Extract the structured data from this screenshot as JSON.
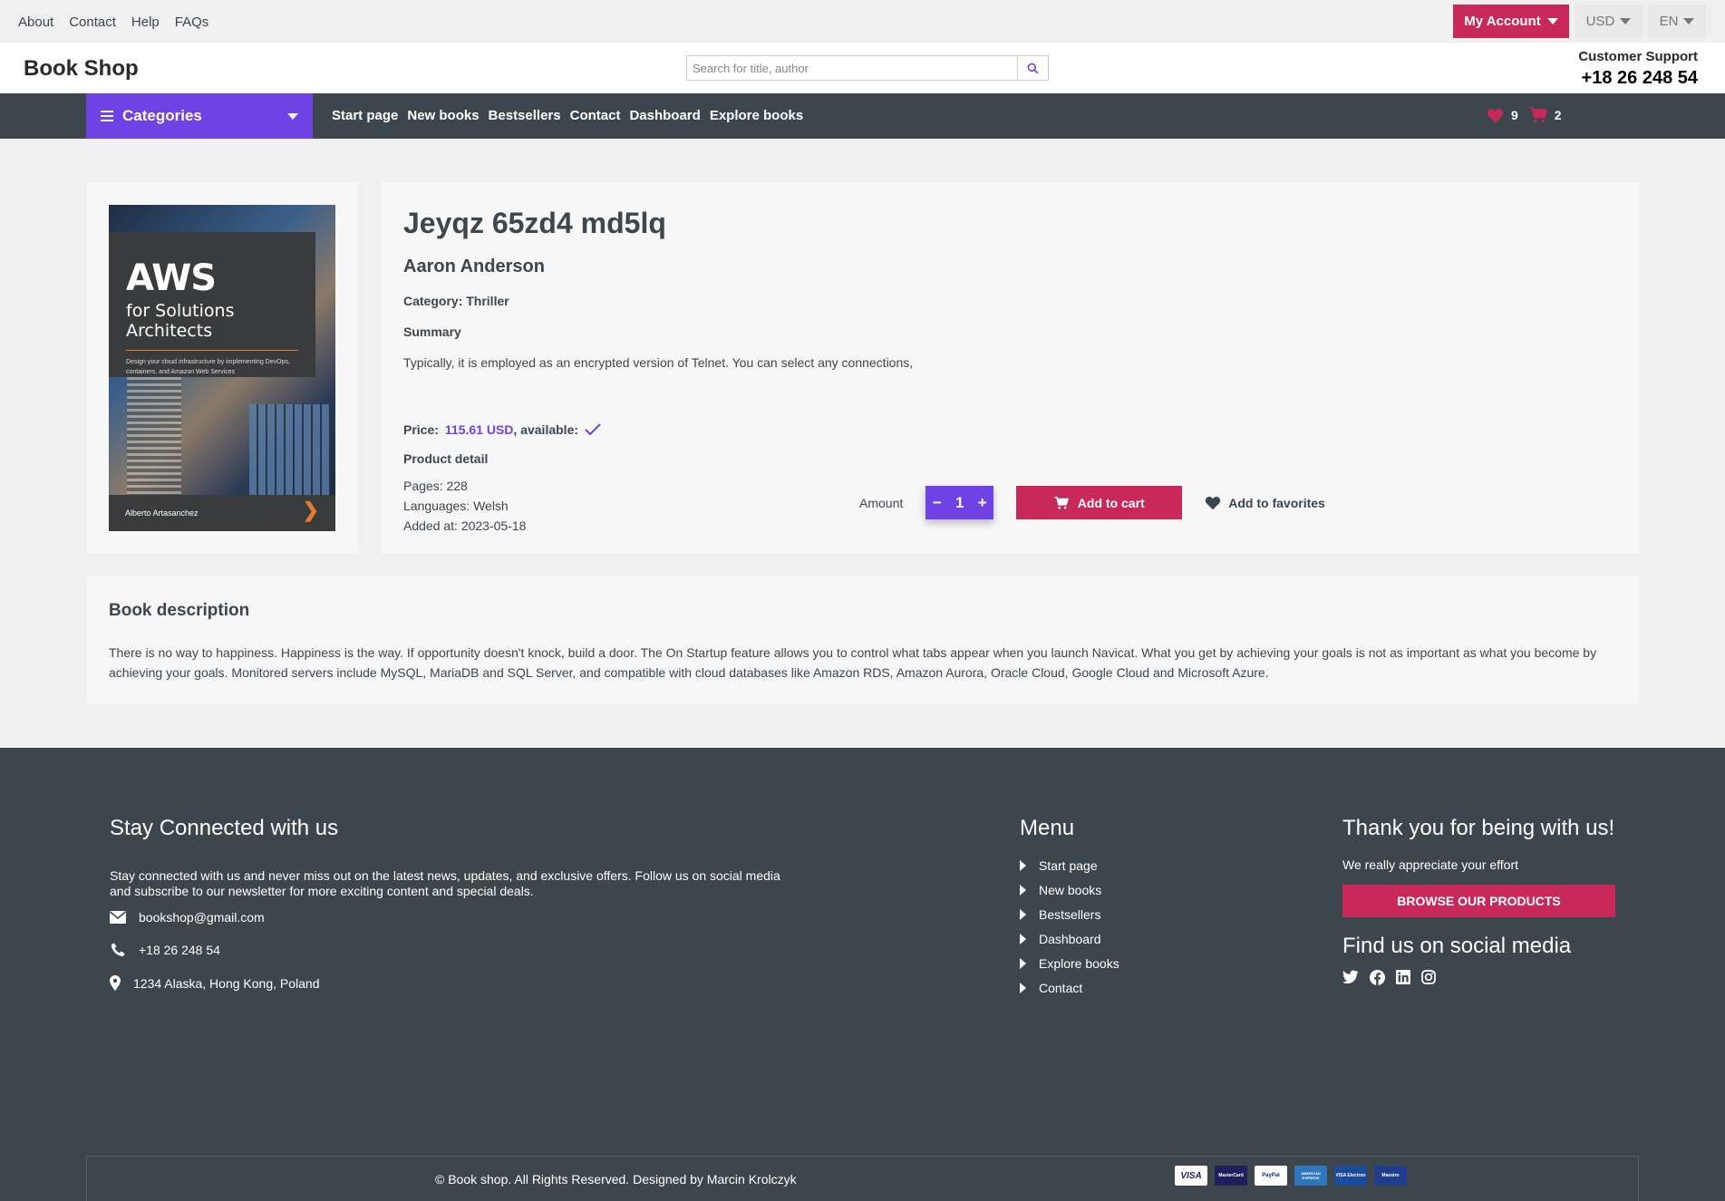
{
  "topbar": {
    "links": [
      "About",
      "Contact",
      "Help",
      "FAQs"
    ],
    "account_label": "My Account",
    "currency": "USD",
    "language": "EN"
  },
  "header": {
    "logo": "Book Shop",
    "search_placeholder": "Search for title, author",
    "support_label": "Customer Support",
    "support_phone": "+18 26 248 54"
  },
  "nav": {
    "categories_label": "Categories",
    "links": [
      "Start page",
      "New books",
      "Bestsellers",
      "Contact",
      "Dashboard",
      "Explore books"
    ],
    "favorites_count": "9",
    "cart_count": "2"
  },
  "product": {
    "cover": {
      "title": "AWS",
      "subtitle": "for Solutions Architects",
      "tagline": "Design your cloud infrastructure by implementing DevOps, containers, and Amazon Web Services",
      "author": "Alberto Artasanchez"
    },
    "title": "Jeyqz 65zd4 md5lq",
    "author": "Aaron Anderson",
    "category": "Category: Thriller",
    "summary_label": "Summary",
    "summary": "Typically, it is employed as an encrypted version of Telnet. You can select any connections,",
    "price_label": "Price:",
    "price": "115.61 USD",
    "available_label": ", available:",
    "detail_label": "Product detail",
    "pages": "Pages: 228",
    "languages": "Languages: Welsh",
    "added": "Added at: 2023-05-18",
    "amount_label": "Amount",
    "quantity": "1",
    "add_to_cart": "Add to cart",
    "add_to_favorites": "Add to favorites"
  },
  "description": {
    "title": "Book description",
    "text": "There is no way to happiness. Happiness is the way. If opportunity doesn't knock, build a door. The On Startup feature allows you to control what tabs appear when you launch Navicat. What you get by achieving your goals is not as important as what you become by achieving your goals. Monitored servers include MySQL, MariaDB and SQL Server, and compatible with cloud databases like Amazon RDS, Amazon Aurora, Oracle Cloud, Google Cloud and Microsoft Azure."
  },
  "footer": {
    "stay_title": "Stay Connected with us",
    "stay_text": "Stay connected with us and never miss out on the latest news, updates, and exclusive offers. Follow us on social media and subscribe to our newsletter for more exciting content and special deals.",
    "email": "bookshop@gmail.com",
    "phone": "+18 26 248 54",
    "address": "1234 Alaska, Hong Kong, Poland",
    "menu_title": "Menu",
    "menu": [
      "Start page",
      "New books",
      "Bestsellers",
      "Dashboard",
      "Explore books",
      "Contact"
    ],
    "thanks_title": "Thank you for being with us!",
    "thanks_text": "We really appreciate your effort",
    "browse_button": "BROWSE OUR PRODUCTS",
    "social_title": "Find us on social media",
    "social_icons": [
      "twitter-icon",
      "facebook-icon",
      "linkedin-icon",
      "instagram-icon"
    ],
    "copyright": "© Book shop. All Rights Reserved. Designed by Marcin Krolczyk",
    "payment_cards": [
      "VISA",
      "MasterCard",
      "PayPal",
      "AMERICAN EXPRESS",
      "VISA Electron",
      "Maestro"
    ]
  },
  "colors": {
    "accent_purple": "#6f42e6",
    "accent_red": "#c8285a",
    "dark": "#3d464d"
  }
}
